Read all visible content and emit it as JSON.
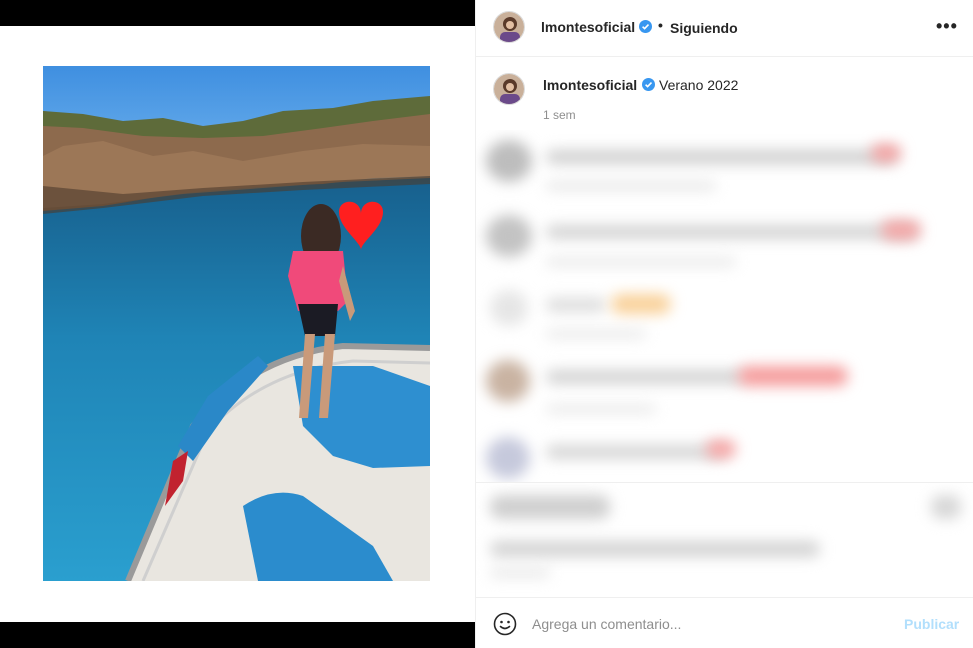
{
  "post": {
    "username": "lmontesoficial",
    "follow_status": "Siguiendo",
    "separator": "•",
    "more_label": "•••",
    "caption": "Verano 2022",
    "time_ago": "1 sem"
  },
  "comment_box": {
    "placeholder": "Agrega un comentario...",
    "publish_label": "Publicar"
  },
  "icons": {
    "verified": "verified-badge-icon",
    "more": "more-options-icon",
    "emoji": "emoji-smiley-icon"
  },
  "colors": {
    "verified": "#3897f0",
    "publish": "#b2dffc",
    "sea": "#1f7fb2",
    "sky": "#4a9ee8",
    "heart": "#ff1f1f"
  }
}
